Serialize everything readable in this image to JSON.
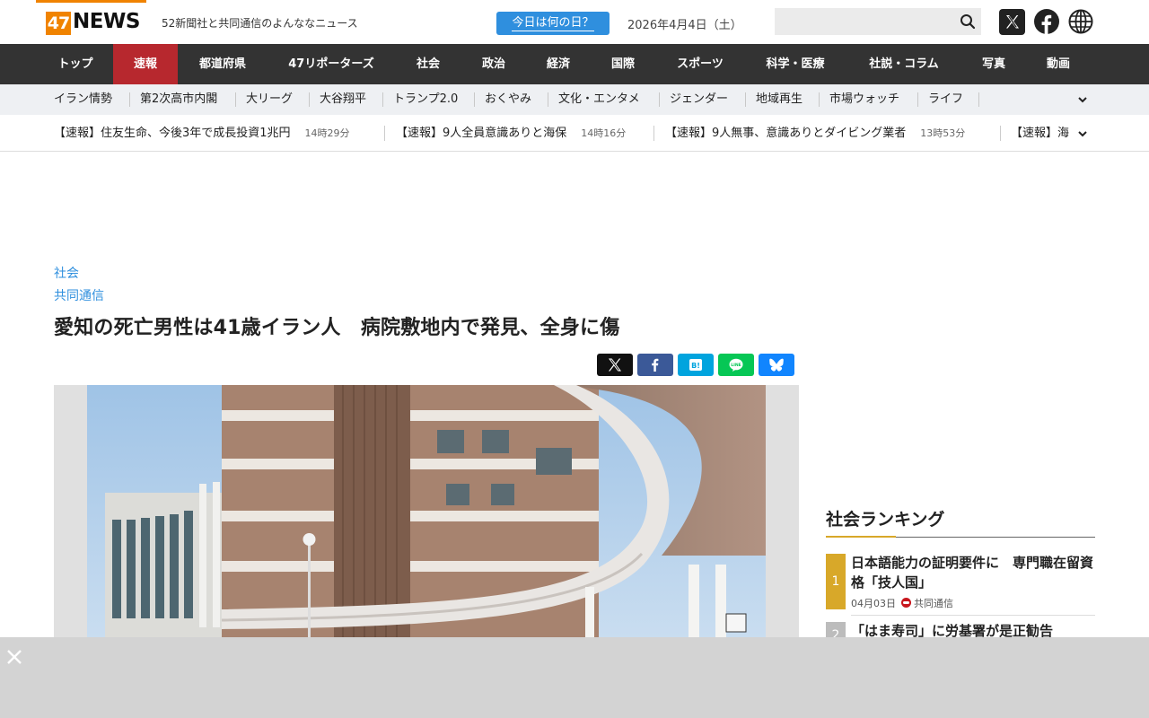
{
  "header": {
    "logo_47": "47",
    "logo_news": "NEWS",
    "tagline": "52新聞社と共同通信のよんななニュース",
    "today_button": "今日は何の日？",
    "date": "2026年4月4日（土）",
    "search_value": "",
    "colors": {
      "brand_orange": "#f08300",
      "link_blue": "#2f8fde",
      "nav_bg": "#333333",
      "active_red": "#b7282e"
    }
  },
  "mainnav": {
    "items": [
      "トップ",
      "速報",
      "都道府県",
      "47リポーターズ",
      "社会",
      "政治",
      "経済",
      "国際",
      "スポーツ",
      "科学・医療",
      "社説・コラム",
      "写真",
      "動画"
    ],
    "active": "速報"
  },
  "subnav": {
    "items": [
      "イラン情勢",
      "第2次高市内閣",
      "大リーグ",
      "大谷翔平",
      "トランプ2.0",
      "おくやみ",
      "文化・エンタメ",
      "ジェンダー",
      "地域再生",
      "市場ウォッチ",
      "ライフ"
    ]
  },
  "breaking": [
    {
      "text": "【速報】住友生命、今後3年で成長投資1兆円",
      "time": "14時29分"
    },
    {
      "text": "【速報】9人全員意識ありと海保",
      "time": "14時16分"
    },
    {
      "text": "【速報】9人無事、意識ありとダイビング業者",
      "time": "13時53分"
    },
    {
      "text": "【速報】海",
      "time": ""
    }
  ],
  "article": {
    "category": "社会",
    "source": "共同通信",
    "title": "愛知の死亡男性は41歳イラン人　病院敷地内で発見、全身に傷",
    "share_buttons": [
      "x-share",
      "facebook-share",
      "hatena-share",
      "line-share",
      "bluesky-share"
    ]
  },
  "sidebar": {
    "ranking_title": "社会ランキング",
    "items": [
      {
        "rank": "1",
        "title": "日本語能力の証明要件に　専門職在留資格「技人国」",
        "date": "04月03日",
        "source": "共同通信"
      },
      {
        "rank": "2",
        "title": "「はま寿司」に労基署が是正勧告"
      }
    ]
  }
}
